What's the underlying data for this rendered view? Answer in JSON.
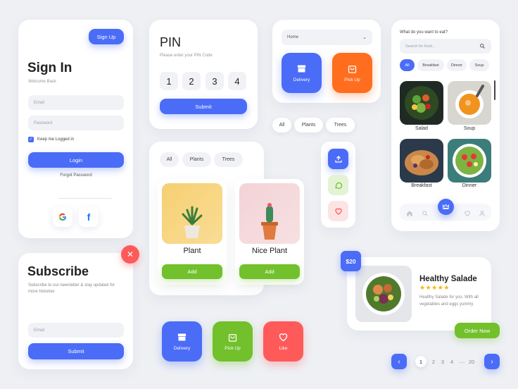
{
  "signin": {
    "signup_label": "Sign Up",
    "title": "Sign In",
    "subtitle": "Welcome Back",
    "email_placeholder": "Email",
    "password_placeholder": "Password",
    "remember_label": "Keep me Logged in",
    "remember_checked": true,
    "login_label": "Login",
    "forgot_label": "Forgot Password"
  },
  "pin": {
    "title": "PIN",
    "subtitle": "Please enter your PIN Code",
    "digits": [
      "1",
      "2",
      "3",
      "4"
    ],
    "submit_label": "Submit"
  },
  "dropdown": {
    "selected": "Home",
    "tiles": [
      {
        "label": "Delivery",
        "icon": "box-icon",
        "color": "#4a6cf7"
      },
      {
        "label": "Pick Up",
        "icon": "bag-icon",
        "color": "#ff6d1f"
      }
    ]
  },
  "filter_chips": [
    "All",
    "Plants",
    "Trees"
  ],
  "plants": {
    "tabs": [
      "All",
      "Plants",
      "Trees"
    ],
    "items": [
      {
        "name": "Plant",
        "button": "Add"
      },
      {
        "name": "Nice Plant",
        "button": "Add"
      }
    ]
  },
  "side_actions": [
    {
      "icon": "upload-icon",
      "color": "#4a6cf7"
    },
    {
      "icon": "chat-icon",
      "color": "#72c02c"
    },
    {
      "icon": "heart-icon",
      "color": "#ff5a5a"
    }
  ],
  "food_app": {
    "question": "What do you want to eat?",
    "search_placeholder": "Search for food...",
    "categories": [
      "All",
      "Breakfast",
      "Dinner",
      "Soup"
    ],
    "items": [
      "Salad",
      "Soup",
      "Breakfast",
      "Dinner"
    ],
    "nav": [
      "home-icon",
      "search-icon",
      "crown-icon",
      "heart-icon",
      "user-icon"
    ]
  },
  "subscribe": {
    "title": "Subscribe",
    "description": "Subscribe to our newsletter & stay updated for more histories",
    "email_placeholder": "Email",
    "submit_label": "Submit"
  },
  "product": {
    "price": "$20",
    "name": "Healthy Salade",
    "stars": 5,
    "description": "Healthy Salade for you. With all vegetables and eggs yummy",
    "order_label": "Order Now"
  },
  "bottom_tiles": [
    {
      "label": "Delivery",
      "icon": "box-icon",
      "color": "#4a6cf7"
    },
    {
      "label": "Pick Up",
      "icon": "bag-icon",
      "color": "#72c02c"
    },
    {
      "label": "Like",
      "icon": "heart-icon",
      "color": "#ff5a5a"
    }
  ],
  "pagination": {
    "pages": [
      "1",
      "2",
      "3",
      "4"
    ],
    "ellipsis": "....",
    "last": "20",
    "active": "1"
  },
  "colors": {
    "primary": "#4a6cf7",
    "green": "#72c02c",
    "orange": "#ff6d1f",
    "red": "#ff5a5a",
    "star": "#f7b500"
  }
}
